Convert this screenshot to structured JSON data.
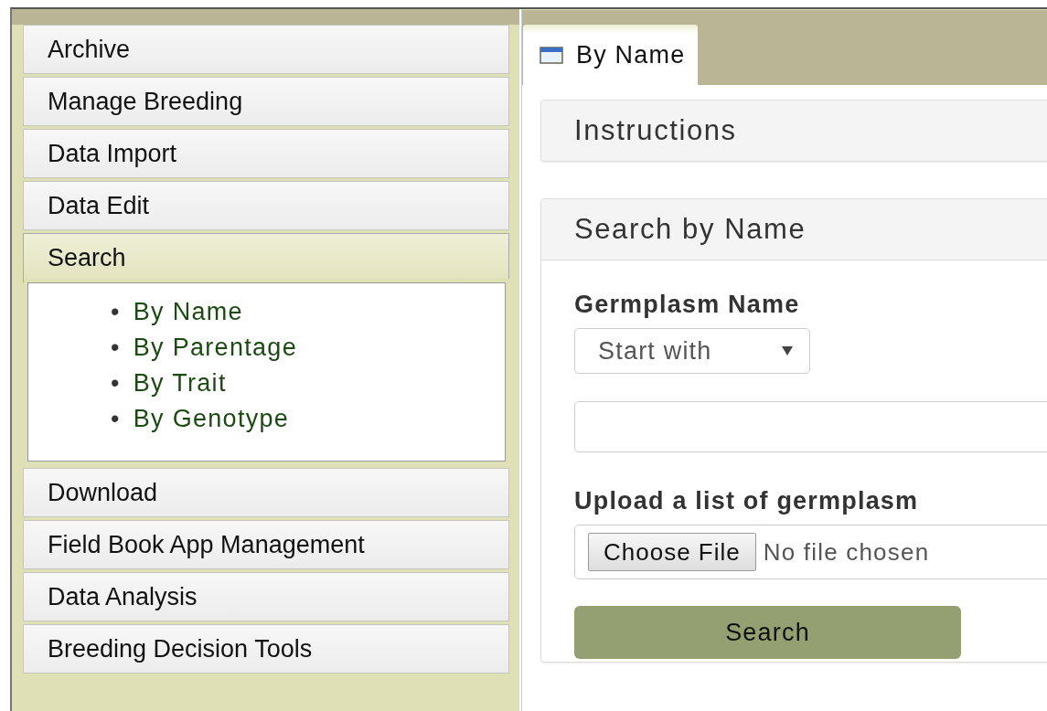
{
  "sidebar": {
    "sections": [
      {
        "label": "Archive",
        "expanded": false
      },
      {
        "label": "Manage Breeding",
        "expanded": false
      },
      {
        "label": "Data Import",
        "expanded": false
      },
      {
        "label": "Data Edit",
        "expanded": false
      },
      {
        "label": "Search",
        "expanded": true,
        "items": [
          {
            "marker": "•",
            "label": "By Name"
          },
          {
            "marker": "•",
            "label": "By Parentage"
          },
          {
            "marker": "•",
            "label": "By Trait"
          },
          {
            "marker": "•",
            "label": "By Genotype"
          }
        ]
      },
      {
        "label": "Download",
        "expanded": false
      },
      {
        "label": "Field Book App Management",
        "expanded": false
      },
      {
        "label": "Data Analysis",
        "expanded": false
      },
      {
        "label": "Breeding Decision Tools",
        "expanded": false
      }
    ]
  },
  "tabs": [
    {
      "label": "By Name",
      "selected": true
    }
  ],
  "instructions_panel": {
    "title": "Instructions"
  },
  "search_panel": {
    "title": "Search by Name",
    "name_label": "Germplasm Name",
    "match_select": {
      "value": "Start with"
    },
    "upload_label": "Upload a list of germplasm",
    "file_button": "Choose File",
    "file_status": "No file chosen",
    "search_button": "Search"
  }
}
